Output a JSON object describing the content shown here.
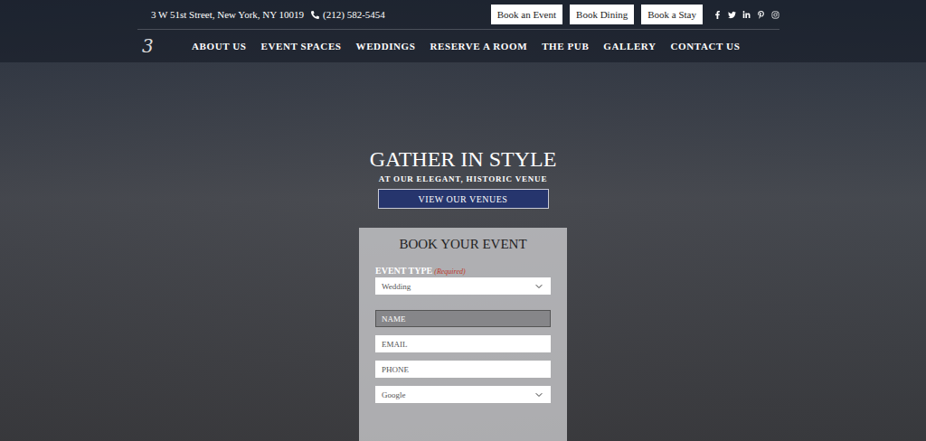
{
  "topbar": {
    "address": "3 W 51st Street, New York, NY 10019",
    "phone": "(212) 582-5454",
    "buttons": [
      "Book an Event",
      "Book Dining",
      "Book a Stay"
    ]
  },
  "logo": "3",
  "nav": [
    "ABOUT US",
    "EVENT SPACES",
    "WEDDINGS",
    "RESERVE A ROOM",
    "THE PUB",
    "GALLERY",
    "CONTACT US"
  ],
  "hero": {
    "title": "GATHER IN STYLE",
    "subtitle": "AT OUR ELEGANT, HISTORIC VENUE",
    "button": "VIEW OUR VENUES"
  },
  "form": {
    "title": "BOOK YOUR EVENT",
    "label": "EVENT TYPE",
    "required": "(Required)",
    "fields": [
      {
        "kind": "select",
        "text": "Wedding",
        "focused": false
      },
      {
        "kind": "input",
        "text": "NAME",
        "focused": true
      },
      {
        "kind": "input",
        "text": "EMAIL",
        "focused": false
      },
      {
        "kind": "input",
        "text": "PHONE",
        "focused": false
      },
      {
        "kind": "select",
        "text": "Google",
        "focused": false
      }
    ]
  }
}
